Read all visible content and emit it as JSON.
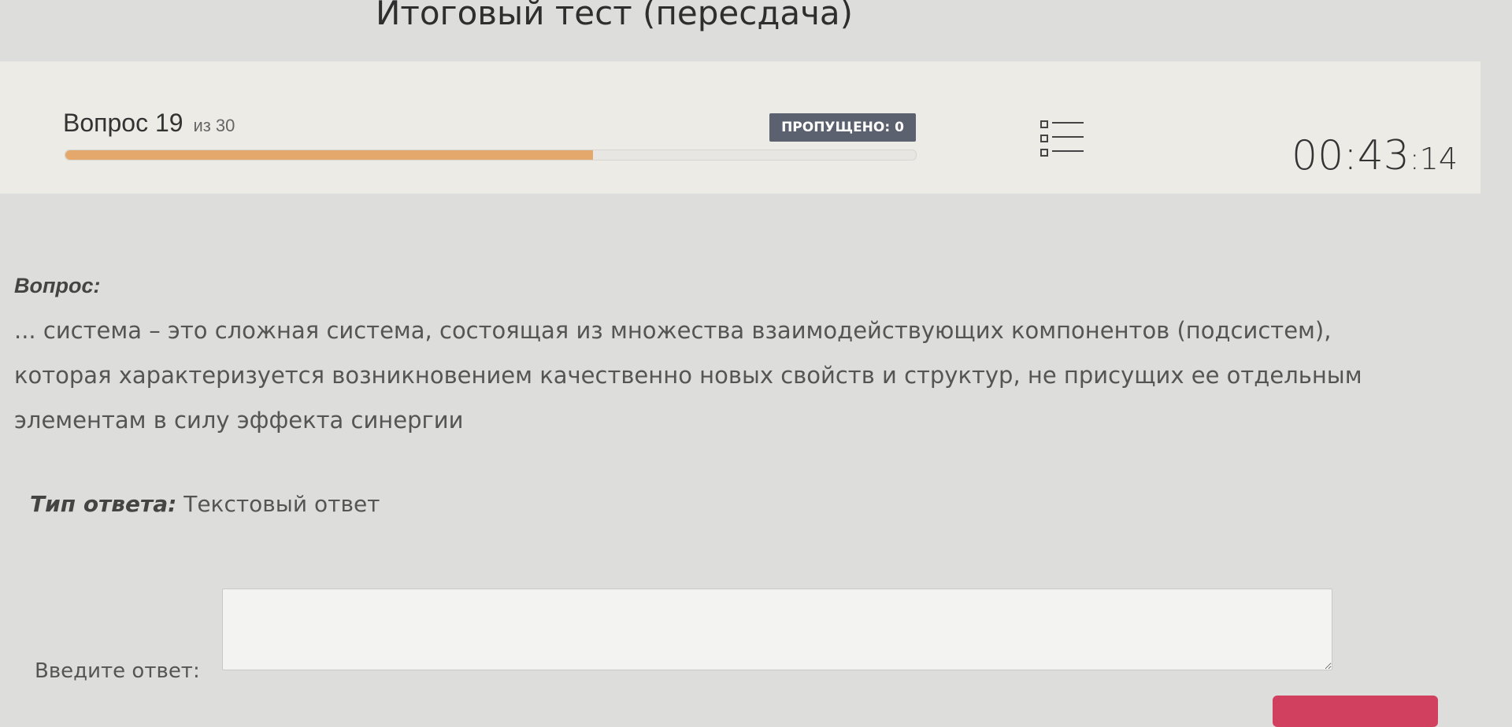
{
  "page": {
    "title": "Итоговый тест (пересдача)"
  },
  "header": {
    "question_label": "Вопрос 19",
    "question_of": "из 30",
    "progress_fraction": 0.62,
    "skipped_label": "ПРОПУЩЕНО: 0",
    "questions_list_icon": "list-icon",
    "timer_main": "00:43",
    "timer_seconds": ":14"
  },
  "question": {
    "label": "Вопрос:",
    "text": "... система – это сложная система, состоящая из множества взаимодействующих компонентов (подсистем), которая характеризуется возникновением качественно новых свойств и структур, не присущих ее отдельным элементам в силу эффекта синергии"
  },
  "answer_type": {
    "label": "Тип ответа:",
    "value": "Текстовый ответ"
  },
  "answer": {
    "label": "Введите ответ:",
    "value": ""
  },
  "colors": {
    "progress": "#e4a76c",
    "badge": "#5c6170",
    "submit": "#d2405f",
    "panel": "#ecebe6"
  }
}
